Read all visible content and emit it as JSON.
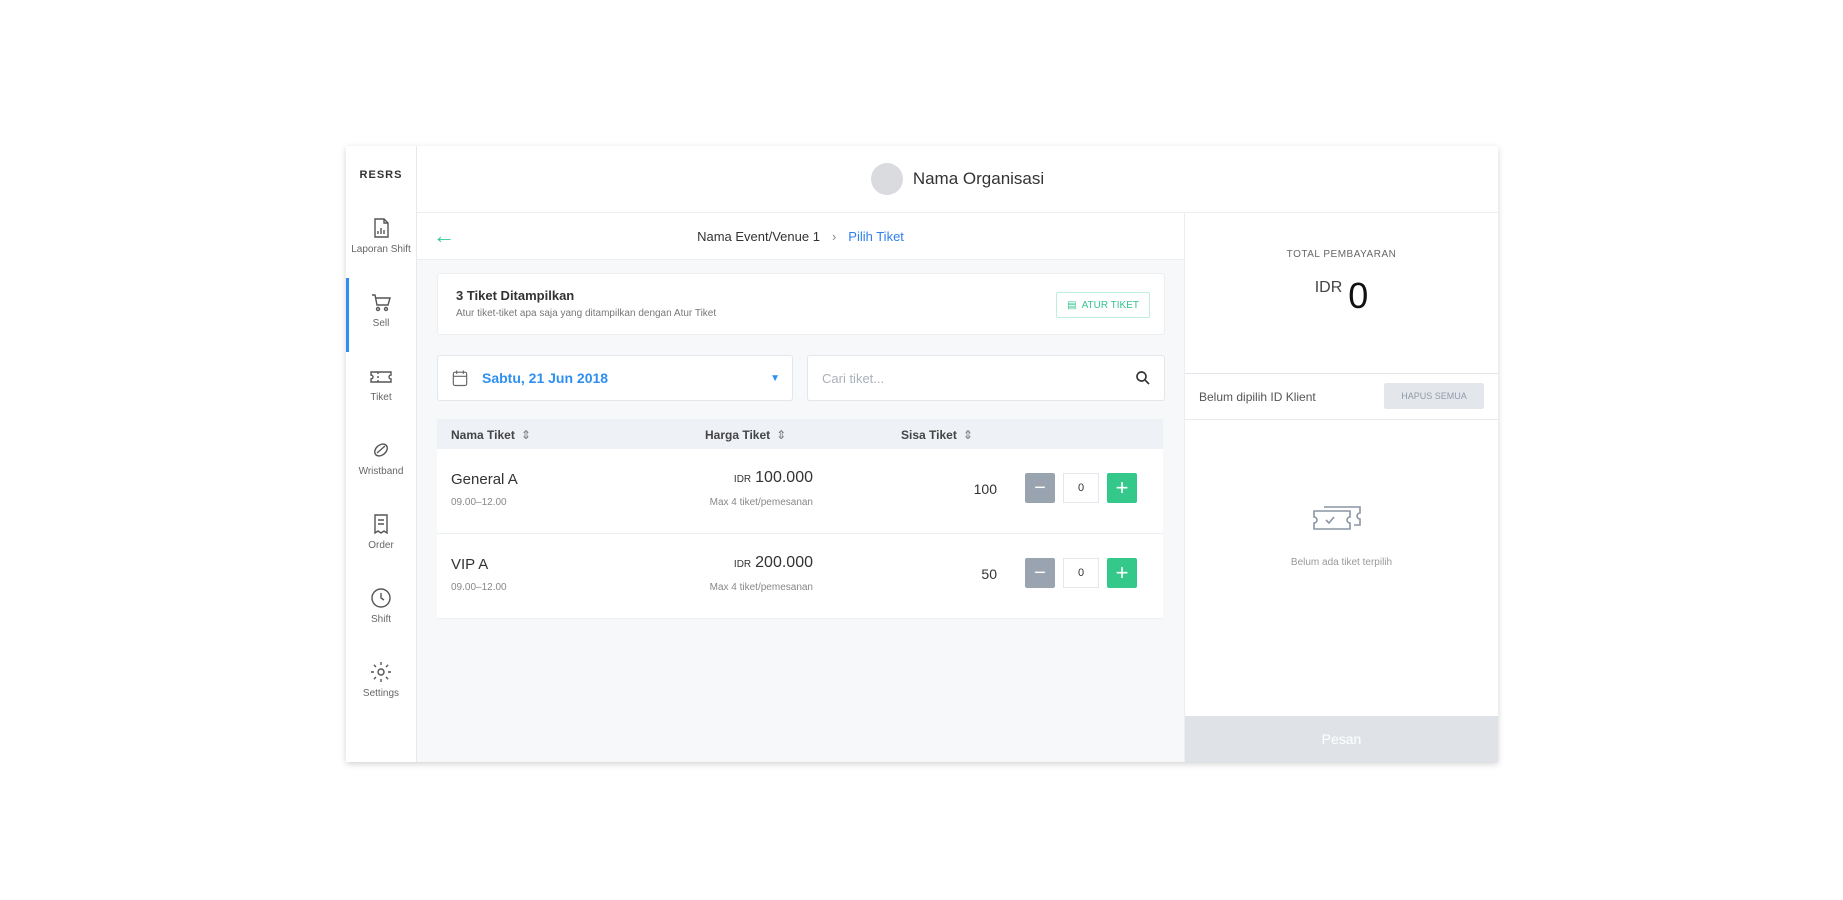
{
  "app": {
    "logo": "RESRS"
  },
  "sidebar": {
    "items": [
      {
        "label": "Laporan Shift",
        "icon": "report-icon"
      },
      {
        "label": "Sell",
        "icon": "cart-icon",
        "active": true
      },
      {
        "label": "Tiket",
        "icon": "ticket-icon"
      },
      {
        "label": "Wristband",
        "icon": "wristband-icon"
      },
      {
        "label": "Order",
        "icon": "receipt-icon"
      },
      {
        "label": "Shift",
        "icon": "clock-icon"
      },
      {
        "label": "Settings",
        "icon": "gear-icon"
      }
    ]
  },
  "header": {
    "org_name": "Nama Organisasi"
  },
  "breadcrumb": {
    "event": "Nama Event/Venue 1",
    "separator": "›",
    "current": "Pilih Tiket"
  },
  "info_card": {
    "title": "3 Tiket Ditampilkan",
    "subtitle": "Atur tiket-tiket apa saja yang ditampilkan dengan Atur Tiket",
    "button": "ATUR TIKET"
  },
  "filters": {
    "date": "Sabtu, 21 Jun 2018",
    "search_placeholder": "Cari tiket..."
  },
  "table": {
    "headers": {
      "name": "Nama Tiket",
      "price": "Harga Tiket",
      "stock": "Sisa Tiket"
    },
    "rows": [
      {
        "name": "General A",
        "time": "09.00–12.00",
        "currency": "IDR",
        "price": "100.000",
        "max": "Max 4 tiket/pemesanan",
        "stock": "100",
        "qty": "0"
      },
      {
        "name": "VIP A",
        "time": "09.00–12.00",
        "currency": "IDR",
        "price": "200.000",
        "max": "Max 4 tiket/pemesanan",
        "stock": "50",
        "qty": "0"
      }
    ]
  },
  "summary": {
    "total_label": "TOTAL PEMBAYARAN",
    "currency": "IDR",
    "total": "0",
    "customer_text": "Belum dipilih ID Klient",
    "clear_button": "HAPUS SEMUA",
    "empty_text": "Belum ada tiket terpilih",
    "order_button": "Pesan"
  },
  "colors": {
    "accent_blue": "#2e8ff0",
    "accent_green": "#34c98a",
    "minus_gray": "#9aa4b1"
  }
}
